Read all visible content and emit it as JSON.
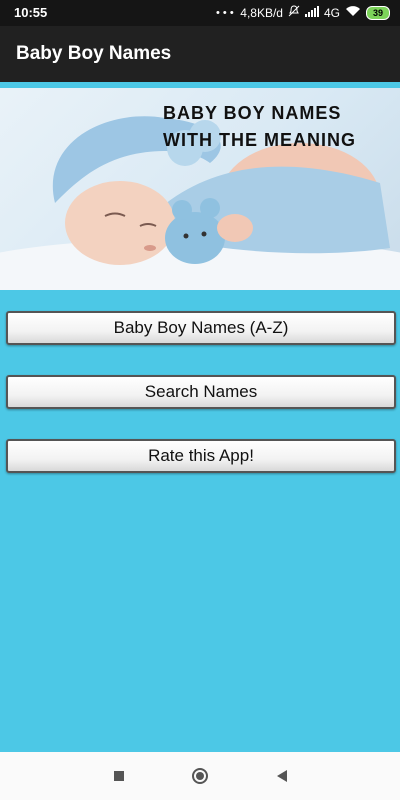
{
  "status": {
    "time": "10:55",
    "net_speed": "4,8KB/d",
    "network": "4G",
    "battery": "39"
  },
  "appbar": {
    "title": "Baby Boy Names"
  },
  "hero": {
    "line1": "BABY BOY NAMES",
    "line2": "WITH THE MEANING"
  },
  "buttons": {
    "names_az": "Baby Boy Names (A-Z)",
    "search": "Search Names",
    "rate": "Rate this App!"
  },
  "colors": {
    "background": "#4cc8e6",
    "appbar": "#212121",
    "statusbar": "#151515"
  },
  "icons": [
    "mute-icon",
    "signal-icon",
    "wifi-icon",
    "battery-icon",
    "recents-icon",
    "home-icon",
    "back-icon"
  ]
}
